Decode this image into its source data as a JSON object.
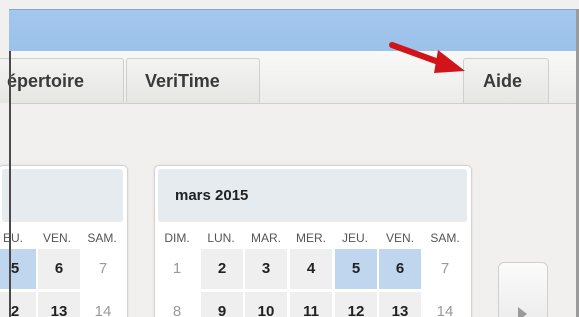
{
  "tabs": {
    "repertoire": "épertoire",
    "veritime": "VeriTime",
    "aide": "Aide"
  },
  "calendar_prev": {
    "weekdays": [
      "EU.",
      "VEN.",
      "SAM."
    ],
    "row1": [
      "5",
      "6",
      "7"
    ],
    "row2": [
      "2",
      "13",
      "14"
    ]
  },
  "calendar_current": {
    "month": "mars 2015",
    "weekdays": [
      "DIM.",
      "LUN.",
      "MAR.",
      "MER.",
      "JEU.",
      "VEN.",
      "SAM."
    ],
    "row1": [
      "1",
      "2",
      "3",
      "4",
      "5",
      "6",
      "7"
    ],
    "row2": [
      "8",
      "9",
      "10",
      "11",
      "12",
      "13",
      "14"
    ]
  },
  "colors": {
    "topbar": "#a4c7ee",
    "arrow": "#d0141a",
    "highlight": "#c0d6ef"
  },
  "icons": {
    "annotation": "red-arrow",
    "next": "triangle-right"
  }
}
